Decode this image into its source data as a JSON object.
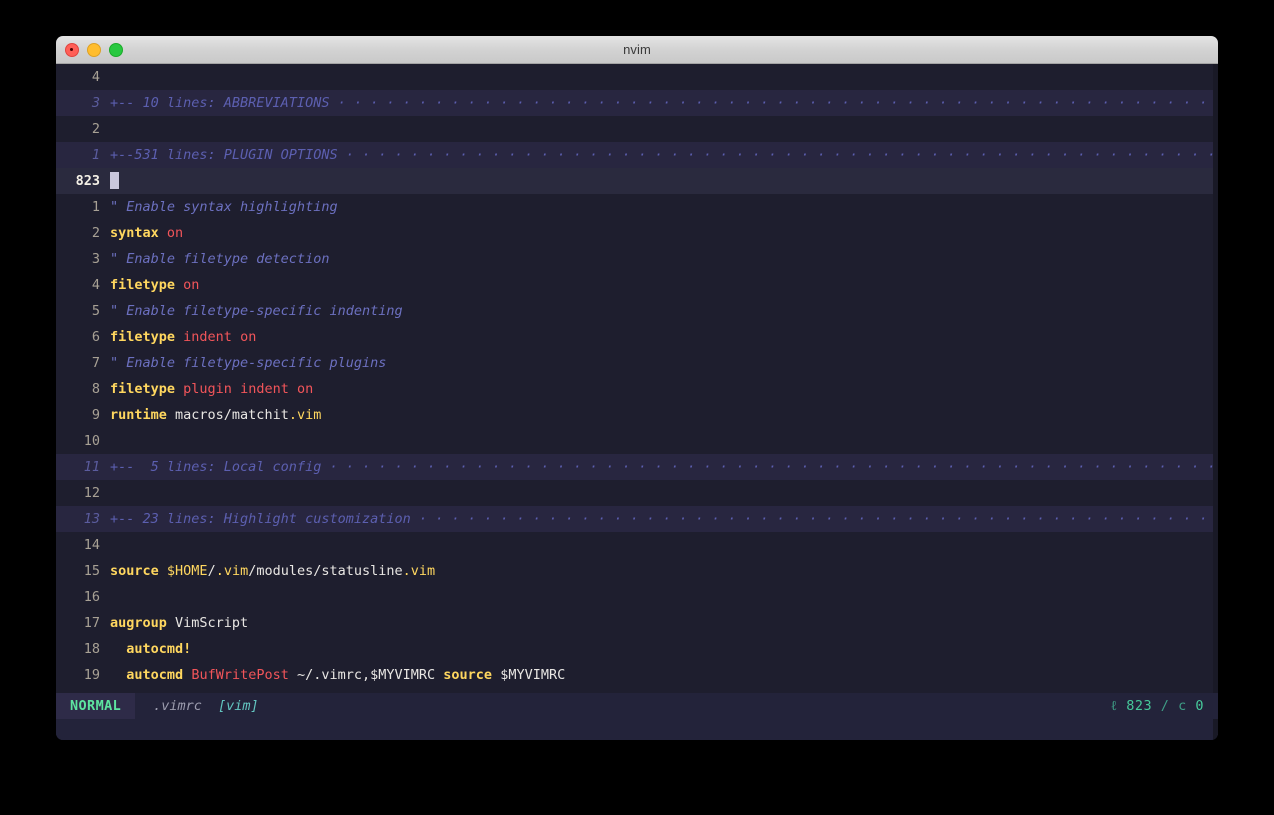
{
  "window": {
    "title": "nvim",
    "traffic_lights": [
      {
        "name": "close",
        "color": "#ff5f57"
      },
      {
        "name": "minimize",
        "color": "#ffbd2e"
      },
      {
        "name": "maximize",
        "color": "#28c840"
      }
    ]
  },
  "theme": {
    "editor_bg": "#1e1e2e",
    "fold_bg": "#282640",
    "cursorline_bg": "#2a2a3e",
    "statusline_bg": "#23233a",
    "comment": "#6c70c0",
    "keyword": "#ffd75f",
    "value": "#f2555a",
    "text": "#e8e6e3",
    "fold_text": "#5c5fb0",
    "mode_green": "#5de4a0",
    "filetype_teal": "#63c5c0"
  },
  "editor": {
    "lines": [
      {
        "num": "4",
        "kind": "blank",
        "tokens": []
      },
      {
        "num": "3",
        "kind": "fold",
        "text": "+-- 10 lines: ABBREVIATIONS ",
        "tokens": []
      },
      {
        "num": "2",
        "kind": "blank",
        "tokens": []
      },
      {
        "num": "1",
        "kind": "fold",
        "text": "+--531 lines: PLUGIN OPTIONS ",
        "tokens": []
      },
      {
        "num": "823",
        "kind": "cursor",
        "tokens": []
      },
      {
        "num": "1",
        "kind": "code",
        "tokens": [
          {
            "t": "comment",
            "s": "\" Enable syntax highlighting"
          }
        ]
      },
      {
        "num": "2",
        "kind": "code",
        "tokens": [
          {
            "t": "kw",
            "s": "syntax"
          },
          {
            "t": "txt",
            "s": " "
          },
          {
            "t": "val",
            "s": "on"
          }
        ]
      },
      {
        "num": "3",
        "kind": "code",
        "tokens": [
          {
            "t": "comment",
            "s": "\" Enable filetype detection"
          }
        ]
      },
      {
        "num": "4",
        "kind": "code",
        "tokens": [
          {
            "t": "kw",
            "s": "filetype"
          },
          {
            "t": "txt",
            "s": " "
          },
          {
            "t": "val",
            "s": "on"
          }
        ]
      },
      {
        "num": "5",
        "kind": "code",
        "tokens": [
          {
            "t": "comment",
            "s": "\" Enable filetype-specific indenting"
          }
        ]
      },
      {
        "num": "6",
        "kind": "code",
        "tokens": [
          {
            "t": "kw",
            "s": "filetype"
          },
          {
            "t": "txt",
            "s": " "
          },
          {
            "t": "val",
            "s": "indent on"
          }
        ]
      },
      {
        "num": "7",
        "kind": "code",
        "tokens": [
          {
            "t": "comment",
            "s": "\" Enable filetype-specific plugins"
          }
        ]
      },
      {
        "num": "8",
        "kind": "code",
        "tokens": [
          {
            "t": "kw",
            "s": "filetype"
          },
          {
            "t": "txt",
            "s": " "
          },
          {
            "t": "val",
            "s": "plugin indent on"
          }
        ]
      },
      {
        "num": "9",
        "kind": "code",
        "tokens": [
          {
            "t": "kw",
            "s": "runtime"
          },
          {
            "t": "txt",
            "s": " macros/matchit"
          },
          {
            "t": "kw2",
            "s": ".vim"
          }
        ]
      },
      {
        "num": "10",
        "kind": "blank",
        "tokens": []
      },
      {
        "num": "11",
        "kind": "fold",
        "text": "+--  5 lines: Local config ",
        "tokens": []
      },
      {
        "num": "12",
        "kind": "blank",
        "tokens": []
      },
      {
        "num": "13",
        "kind": "fold",
        "text": "+-- 23 lines: Highlight customization ",
        "tokens": []
      },
      {
        "num": "14",
        "kind": "blank",
        "tokens": []
      },
      {
        "num": "15",
        "kind": "code",
        "tokens": [
          {
            "t": "kw",
            "s": "source"
          },
          {
            "t": "txt",
            "s": " "
          },
          {
            "t": "var",
            "s": "$HOME"
          },
          {
            "t": "txt",
            "s": "/"
          },
          {
            "t": "kw2",
            "s": ".vim"
          },
          {
            "t": "txt",
            "s": "/modules/statusline"
          },
          {
            "t": "kw2",
            "s": ".vim"
          }
        ]
      },
      {
        "num": "16",
        "kind": "blank",
        "tokens": []
      },
      {
        "num": "17",
        "kind": "code",
        "tokens": [
          {
            "t": "kw",
            "s": "augroup"
          },
          {
            "t": "txt",
            "s": " VimScript"
          }
        ]
      },
      {
        "num": "18",
        "kind": "code",
        "tokens": [
          {
            "t": "txt",
            "s": "  "
          },
          {
            "t": "kw",
            "s": "autocmd!"
          }
        ]
      },
      {
        "num": "19",
        "kind": "code",
        "tokens": [
          {
            "t": "txt",
            "s": "  "
          },
          {
            "t": "kw",
            "s": "autocmd"
          },
          {
            "t": "txt",
            "s": " "
          },
          {
            "t": "val",
            "s": "BufWritePost"
          },
          {
            "t": "txt",
            "s": " ~/.vimrc,$MYVIMRC "
          },
          {
            "t": "kw",
            "s": "source"
          },
          {
            "t": "txt",
            "s": " $MYVIMRC"
          }
        ]
      }
    ],
    "fold_fill_char": "·"
  },
  "statusline": {
    "mode": "NORMAL",
    "filename": ".vimrc",
    "filetype": "[vim]",
    "line_icon": "ℓ",
    "line_number": "823",
    "separator": "/",
    "col_icon": "c",
    "col_number": "0"
  }
}
